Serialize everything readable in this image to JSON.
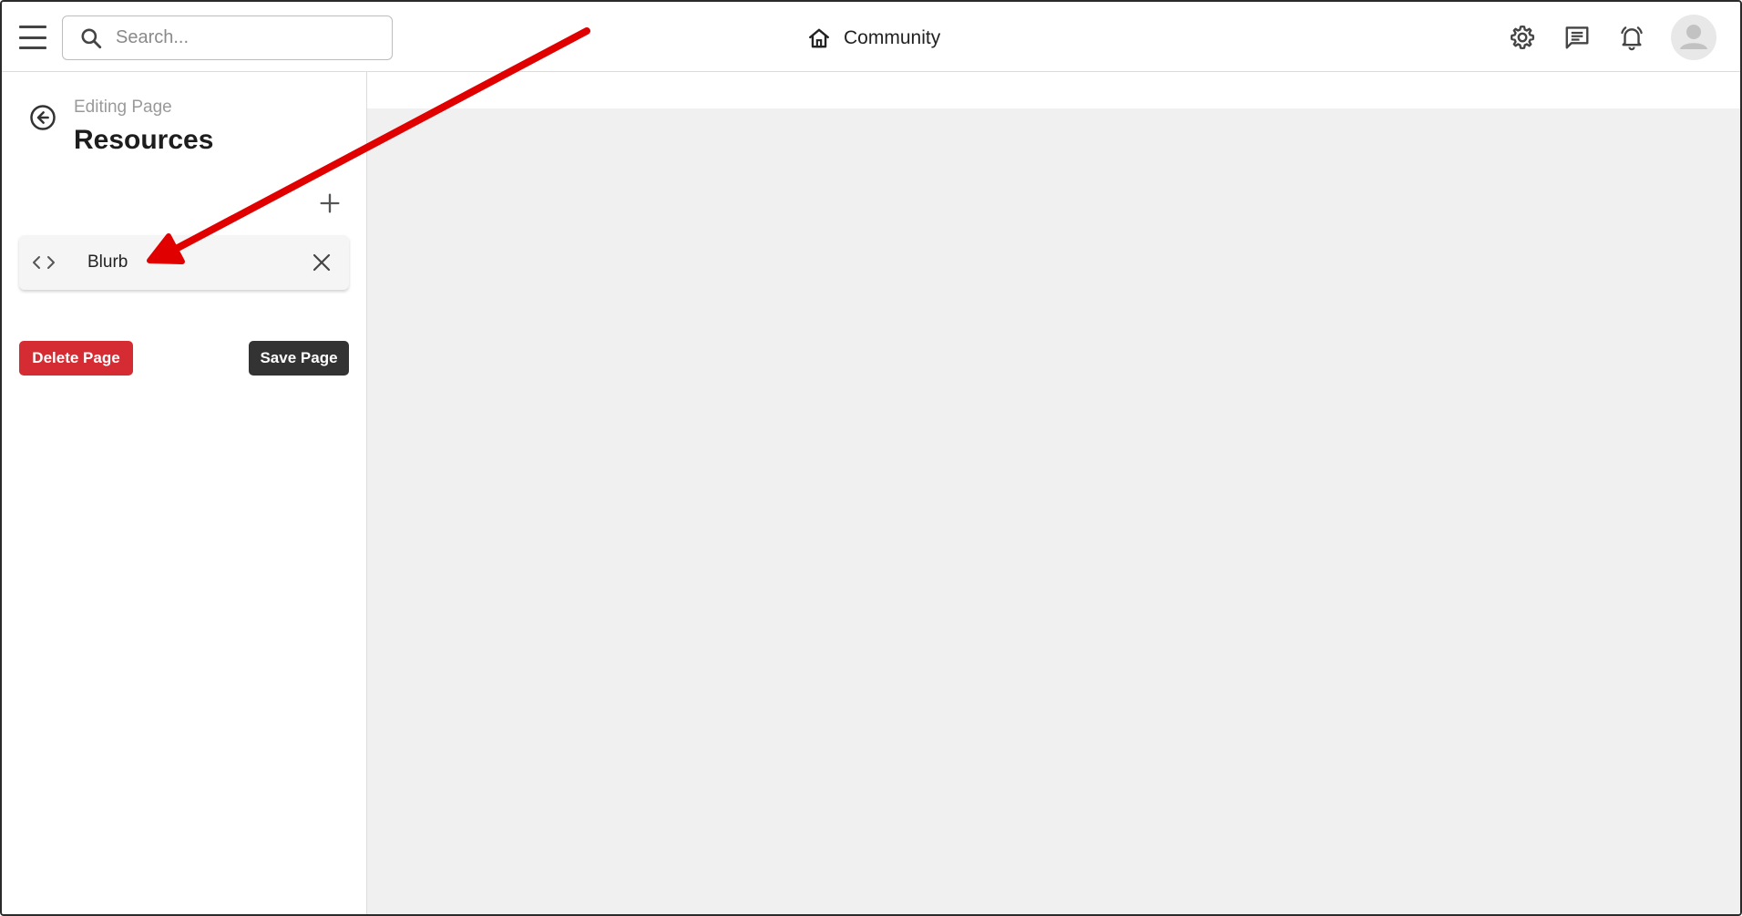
{
  "header": {
    "search_placeholder": "Search...",
    "brand_label": "Community",
    "icons": [
      "menu-icon",
      "search-icon",
      "home-icon",
      "gear-icon",
      "chat-icon",
      "bell-icon",
      "avatar-icon"
    ]
  },
  "sidebar": {
    "editing_label": "Editing Page",
    "page_title": "Resources",
    "blocks": [
      {
        "label": "Blurb",
        "icon": "code-icon"
      }
    ],
    "delete_label": "Delete Page",
    "save_label": "Save Page"
  },
  "colors": {
    "delete": "#d52c33",
    "save": "#333333",
    "annotation_arrow": "#e00000",
    "main_background": "#f0f0f0"
  }
}
